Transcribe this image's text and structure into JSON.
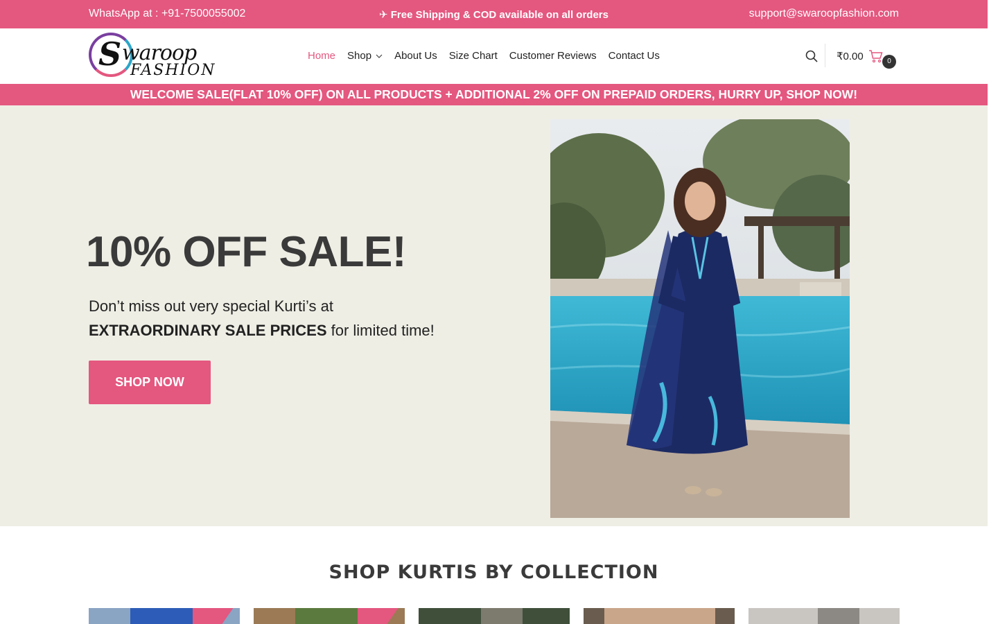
{
  "topbar": {
    "whatsapp": "WhatsApp at : +91-7500055002",
    "shipping": "✈ Free Shipping & COD available on all orders",
    "email": "support@swaroopfashion.com"
  },
  "logo": {
    "s": "S",
    "word": "waroop",
    "fashion": "FASHION"
  },
  "nav": [
    {
      "label": "Home",
      "active": true
    },
    {
      "label": "Shop",
      "dropdown": true
    },
    {
      "label": "About Us"
    },
    {
      "label": "Size Chart"
    },
    {
      "label": "Customer Reviews"
    },
    {
      "label": "Contact Us"
    }
  ],
  "header": {
    "cart_amount": "₹0.00",
    "cart_count": "0"
  },
  "sale_banner": "WELCOME SALE(FLAT 10% OFF) ON ALL PRODUCTS + ADDITIONAL 2% OFF ON PREPAID ORDERS, HURRY UP, SHOP NOW!",
  "hero": {
    "title": "10% OFF SALE!",
    "text_line1": "Don’t miss out very special Kurti’s at",
    "text_bold": "EXTRAORDINARY SALE PRICES",
    "text_rest": " for limited time!",
    "button": "SHOP NOW"
  },
  "collection": {
    "title": "SHOP KURTIS BY COLLECTION"
  },
  "colors": {
    "brand_pink": "#e4577f",
    "hero_bg": "#efeee5",
    "text_dark": "#3a3a3a"
  },
  "icons": [
    "search-icon",
    "cart-icon",
    "chevron-down-icon",
    "plane-icon"
  ]
}
